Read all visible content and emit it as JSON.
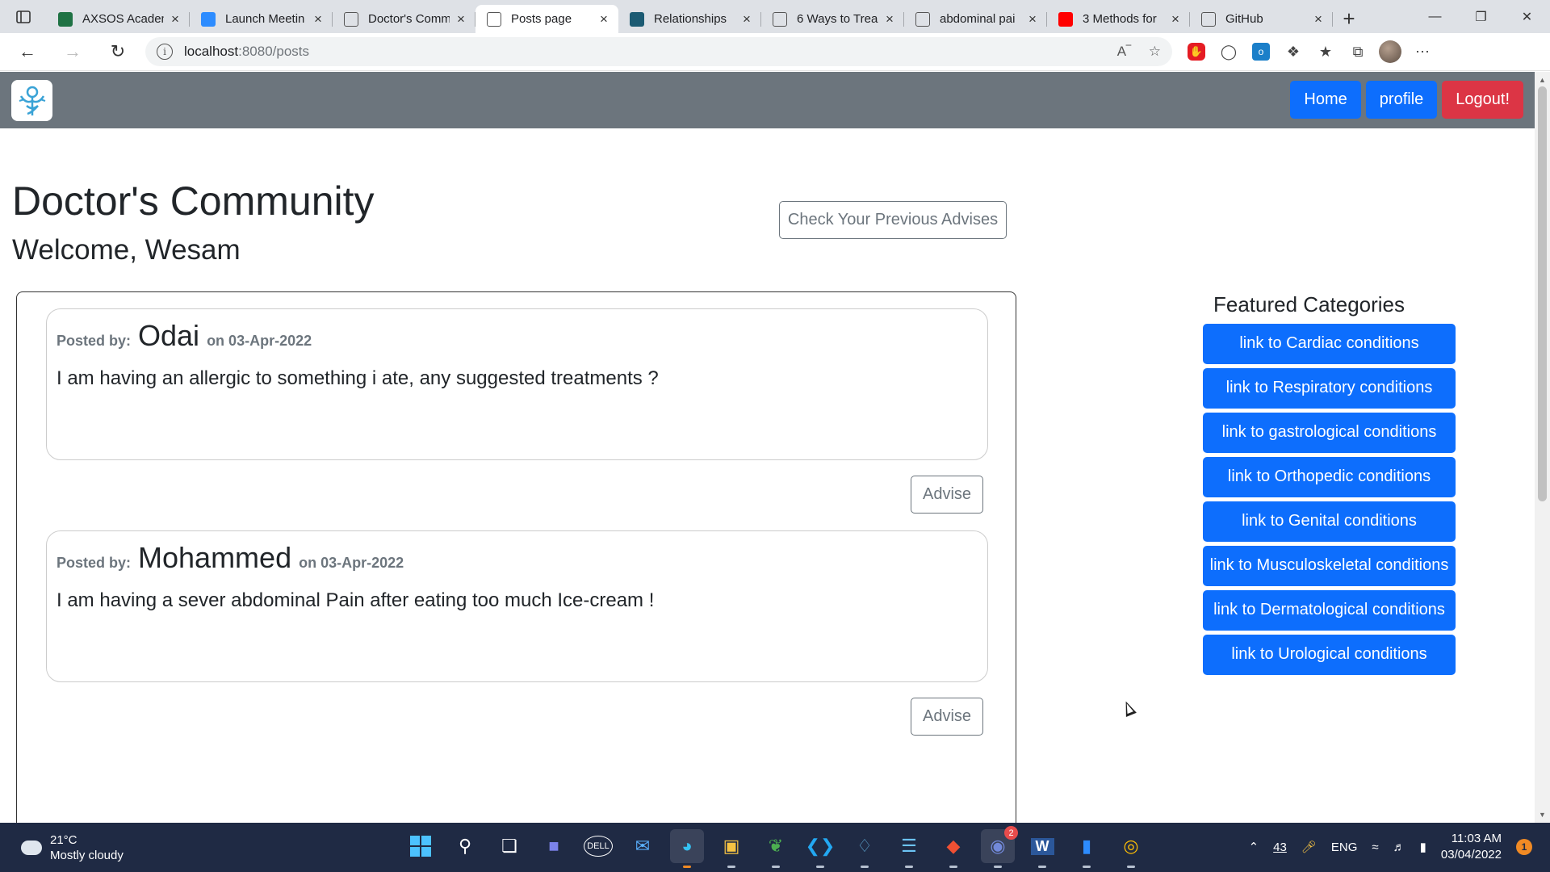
{
  "browser": {
    "tabs": [
      {
        "label": "AXSOS Academ",
        "favicon": "excel-icon",
        "color": "#1f7244",
        "active": false
      },
      {
        "label": "Launch Meetin",
        "favicon": "zoom-icon",
        "color": "#2d8cff",
        "active": false
      },
      {
        "label": "Doctor's Comm",
        "favicon": "page-icon",
        "color": "#ffffff",
        "active": false
      },
      {
        "label": "Posts page",
        "favicon": "page-icon",
        "color": "#ffffff",
        "active": true
      },
      {
        "label": "Relationships",
        "favicon": "site-icon",
        "color": "#1c5b73",
        "active": false
      },
      {
        "label": "6 Ways to Trea",
        "favicon": "webmd-icon",
        "color": "#ffffff",
        "active": false
      },
      {
        "label": "abdominal pai",
        "favicon": "google-icon",
        "color": "#ffffff",
        "active": false
      },
      {
        "label": "3 Methods for",
        "favicon": "youtube-icon",
        "color": "#ff0000",
        "active": false
      },
      {
        "label": "GitHub",
        "favicon": "github-icon",
        "color": "#ffffff",
        "active": false
      }
    ],
    "url_host": "localhost",
    "url_path": ":8080/posts"
  },
  "app": {
    "nav": {
      "home": "Home",
      "profile": "profile",
      "logout": "Logout!"
    },
    "title": "Doctor's Community",
    "welcome": "Welcome, Wesam",
    "previous_advises_button": "Check Your Previous Advises",
    "posts": [
      {
        "posted_by_label": "Posted by:",
        "author": "Odai",
        "date": "on 03-Apr-2022",
        "body": "I am having an allergic to something i ate, any suggested treatments ?",
        "advise_label": "Advise"
      },
      {
        "posted_by_label": "Posted by:",
        "author": "Mohammed",
        "date": "on 03-Apr-2022",
        "body": "I am having a sever abdominal Pain after eating too much Ice-cream !",
        "advise_label": "Advise"
      }
    ],
    "featured": {
      "title": "Featured Categories",
      "links": [
        "link to Cardiac conditions",
        "link to Respiratory conditions",
        "link to gastrological conditions",
        "link to Orthopedic conditions",
        "link to Genital conditions",
        "link to Musculoskeletal conditions",
        "link to Dermatological conditions",
        "link to Urological conditions"
      ]
    },
    "colors": {
      "navbar": "#6c757d",
      "primary": "#0d6efd",
      "danger": "#dc3545"
    }
  },
  "taskbar": {
    "temperature": "21°C",
    "weather": "Mostly cloudy",
    "tray_count": "43",
    "language": "ENG",
    "time": "11:03 AM",
    "date": "03/04/2022",
    "notification_count": "1",
    "discord_badge": "2"
  }
}
